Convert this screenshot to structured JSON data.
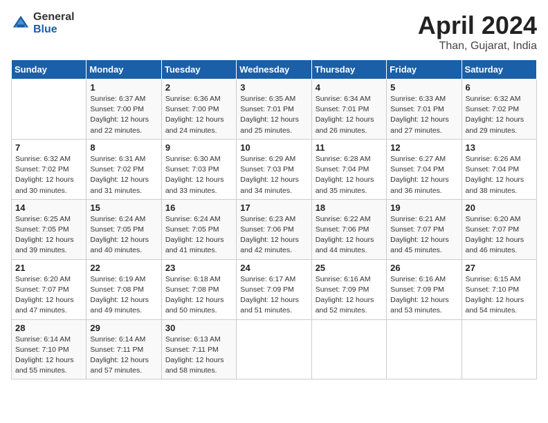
{
  "header": {
    "logo_general": "General",
    "logo_blue": "Blue",
    "title": "April 2024",
    "location": "Than, Gujarat, India"
  },
  "columns": [
    "Sunday",
    "Monday",
    "Tuesday",
    "Wednesday",
    "Thursday",
    "Friday",
    "Saturday"
  ],
  "weeks": [
    [
      {
        "day": "",
        "info": ""
      },
      {
        "day": "1",
        "info": "Sunrise: 6:37 AM\nSunset: 7:00 PM\nDaylight: 12 hours\nand 22 minutes."
      },
      {
        "day": "2",
        "info": "Sunrise: 6:36 AM\nSunset: 7:00 PM\nDaylight: 12 hours\nand 24 minutes."
      },
      {
        "day": "3",
        "info": "Sunrise: 6:35 AM\nSunset: 7:01 PM\nDaylight: 12 hours\nand 25 minutes."
      },
      {
        "day": "4",
        "info": "Sunrise: 6:34 AM\nSunset: 7:01 PM\nDaylight: 12 hours\nand 26 minutes."
      },
      {
        "day": "5",
        "info": "Sunrise: 6:33 AM\nSunset: 7:01 PM\nDaylight: 12 hours\nand 27 minutes."
      },
      {
        "day": "6",
        "info": "Sunrise: 6:32 AM\nSunset: 7:02 PM\nDaylight: 12 hours\nand 29 minutes."
      }
    ],
    [
      {
        "day": "7",
        "info": "Sunrise: 6:32 AM\nSunset: 7:02 PM\nDaylight: 12 hours\nand 30 minutes."
      },
      {
        "day": "8",
        "info": "Sunrise: 6:31 AM\nSunset: 7:02 PM\nDaylight: 12 hours\nand 31 minutes."
      },
      {
        "day": "9",
        "info": "Sunrise: 6:30 AM\nSunset: 7:03 PM\nDaylight: 12 hours\nand 33 minutes."
      },
      {
        "day": "10",
        "info": "Sunrise: 6:29 AM\nSunset: 7:03 PM\nDaylight: 12 hours\nand 34 minutes."
      },
      {
        "day": "11",
        "info": "Sunrise: 6:28 AM\nSunset: 7:04 PM\nDaylight: 12 hours\nand 35 minutes."
      },
      {
        "day": "12",
        "info": "Sunrise: 6:27 AM\nSunset: 7:04 PM\nDaylight: 12 hours\nand 36 minutes."
      },
      {
        "day": "13",
        "info": "Sunrise: 6:26 AM\nSunset: 7:04 PM\nDaylight: 12 hours\nand 38 minutes."
      }
    ],
    [
      {
        "day": "14",
        "info": "Sunrise: 6:25 AM\nSunset: 7:05 PM\nDaylight: 12 hours\nand 39 minutes."
      },
      {
        "day": "15",
        "info": "Sunrise: 6:24 AM\nSunset: 7:05 PM\nDaylight: 12 hours\nand 40 minutes."
      },
      {
        "day": "16",
        "info": "Sunrise: 6:24 AM\nSunset: 7:05 PM\nDaylight: 12 hours\nand 41 minutes."
      },
      {
        "day": "17",
        "info": "Sunrise: 6:23 AM\nSunset: 7:06 PM\nDaylight: 12 hours\nand 42 minutes."
      },
      {
        "day": "18",
        "info": "Sunrise: 6:22 AM\nSunset: 7:06 PM\nDaylight: 12 hours\nand 44 minutes."
      },
      {
        "day": "19",
        "info": "Sunrise: 6:21 AM\nSunset: 7:07 PM\nDaylight: 12 hours\nand 45 minutes."
      },
      {
        "day": "20",
        "info": "Sunrise: 6:20 AM\nSunset: 7:07 PM\nDaylight: 12 hours\nand 46 minutes."
      }
    ],
    [
      {
        "day": "21",
        "info": "Sunrise: 6:20 AM\nSunset: 7:07 PM\nDaylight: 12 hours\nand 47 minutes."
      },
      {
        "day": "22",
        "info": "Sunrise: 6:19 AM\nSunset: 7:08 PM\nDaylight: 12 hours\nand 49 minutes."
      },
      {
        "day": "23",
        "info": "Sunrise: 6:18 AM\nSunset: 7:08 PM\nDaylight: 12 hours\nand 50 minutes."
      },
      {
        "day": "24",
        "info": "Sunrise: 6:17 AM\nSunset: 7:09 PM\nDaylight: 12 hours\nand 51 minutes."
      },
      {
        "day": "25",
        "info": "Sunrise: 6:16 AM\nSunset: 7:09 PM\nDaylight: 12 hours\nand 52 minutes."
      },
      {
        "day": "26",
        "info": "Sunrise: 6:16 AM\nSunset: 7:09 PM\nDaylight: 12 hours\nand 53 minutes."
      },
      {
        "day": "27",
        "info": "Sunrise: 6:15 AM\nSunset: 7:10 PM\nDaylight: 12 hours\nand 54 minutes."
      }
    ],
    [
      {
        "day": "28",
        "info": "Sunrise: 6:14 AM\nSunset: 7:10 PM\nDaylight: 12 hours\nand 55 minutes."
      },
      {
        "day": "29",
        "info": "Sunrise: 6:14 AM\nSunset: 7:11 PM\nDaylight: 12 hours\nand 57 minutes."
      },
      {
        "day": "30",
        "info": "Sunrise: 6:13 AM\nSunset: 7:11 PM\nDaylight: 12 hours\nand 58 minutes."
      },
      {
        "day": "",
        "info": ""
      },
      {
        "day": "",
        "info": ""
      },
      {
        "day": "",
        "info": ""
      },
      {
        "day": "",
        "info": ""
      }
    ]
  ]
}
